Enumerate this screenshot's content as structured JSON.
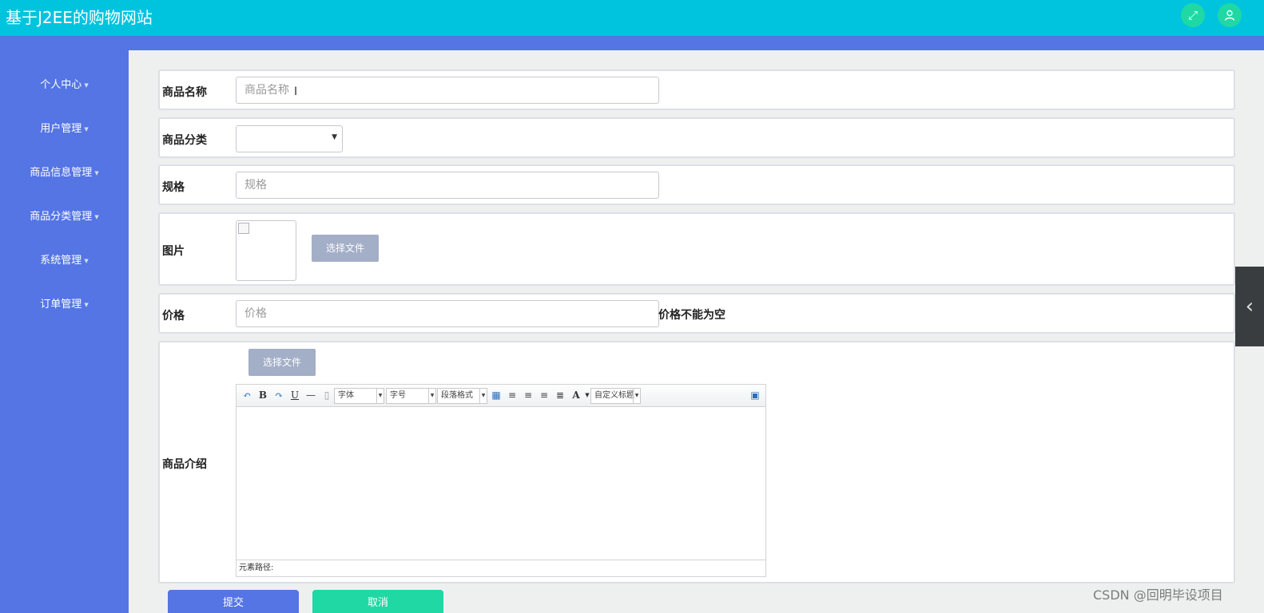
{
  "header": {
    "title": "基于J2EE的购物网站"
  },
  "sidebar": {
    "items": [
      {
        "label": "个人中心"
      },
      {
        "label": "用户管理"
      },
      {
        "label": "商品信息管理"
      },
      {
        "label": "商品分类管理"
      },
      {
        "label": "系统管理"
      },
      {
        "label": "订单管理"
      }
    ]
  },
  "form": {
    "name": {
      "label": "商品名称",
      "placeholder": "商品名称",
      "value": ""
    },
    "category": {
      "label": "商品分类",
      "selected": ""
    },
    "spec": {
      "label": "规格",
      "placeholder": "规格",
      "value": ""
    },
    "image": {
      "label": "图片",
      "file_button": "选择文件"
    },
    "price": {
      "label": "价格",
      "placeholder": "价格",
      "value": "",
      "error": "价格不能为空"
    },
    "intro": {
      "label": "商品介绍",
      "file_button": "选择文件",
      "toolbar": {
        "font_family": "字体",
        "font_size": "字号",
        "paragraph": "段落格式",
        "custom_title": "自定义标题"
      },
      "element_path": "元素路径:"
    }
  },
  "actions": {
    "submit": "提交",
    "cancel": "取消"
  },
  "watermark": "CSDN @回明毕设项目",
  "colors": {
    "topbar": "#00c4de",
    "sidebar": "#5475e3",
    "submit": "#5475e3",
    "cancel": "#1fd8a4"
  }
}
